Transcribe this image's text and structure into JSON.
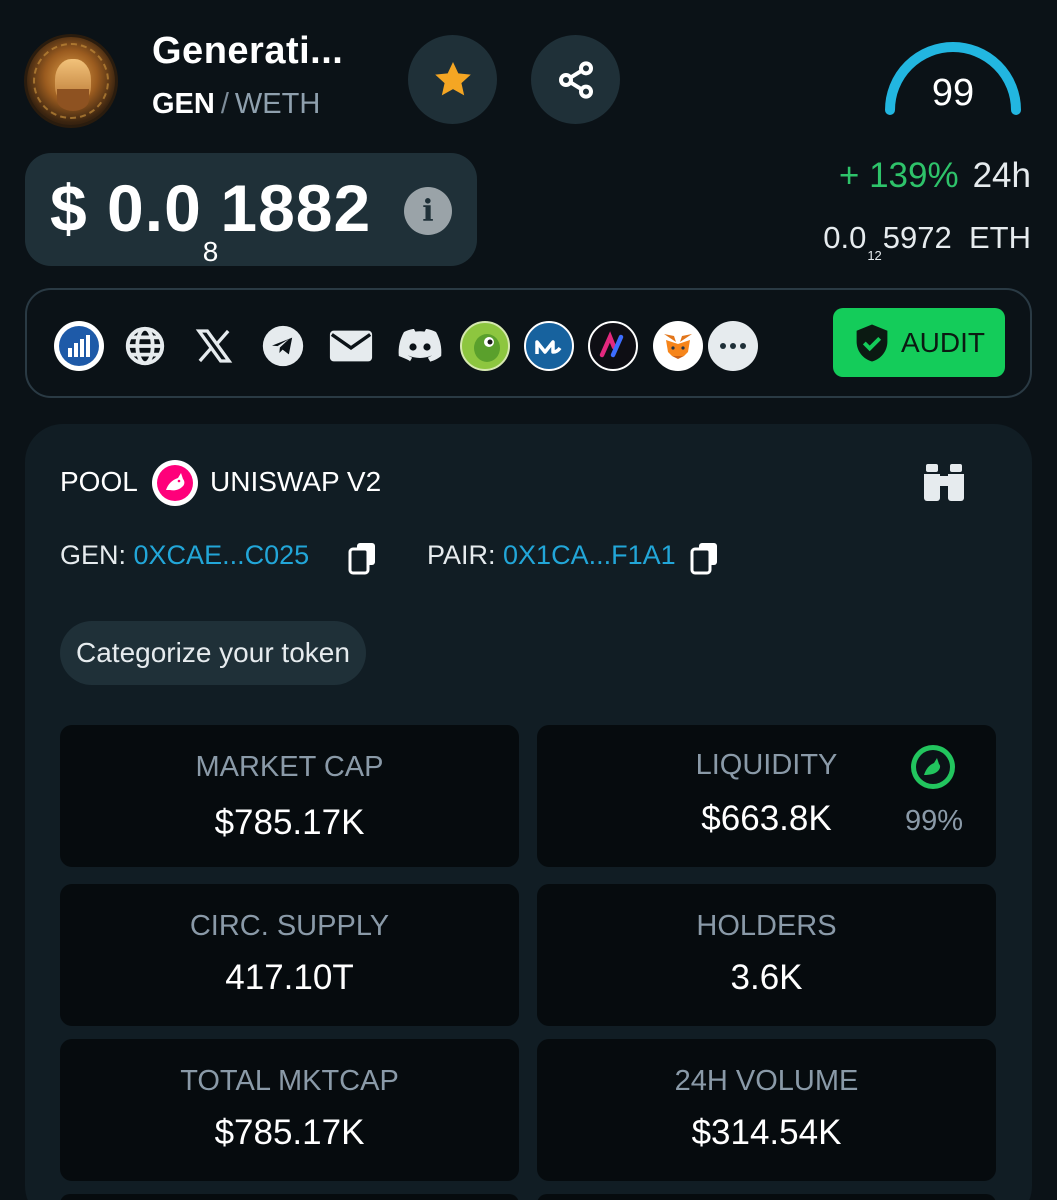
{
  "token": {
    "name": "Generati...",
    "base_symbol": "GEN",
    "separator": "/",
    "quote_symbol": "WETH"
  },
  "header_actions": {
    "favorite_icon": "star-icon",
    "share_icon": "share-icon"
  },
  "score": {
    "value": "99",
    "level": 0.99
  },
  "price": {
    "prefix": "$ 0.0",
    "zero_count": "8",
    "digits": "1882",
    "info_icon": "info-icon"
  },
  "change": {
    "value": "+ 139%",
    "period": "24h",
    "color": "#2ec36a"
  },
  "eth_price": {
    "prefix": "0.0",
    "zero_count": "12",
    "digits": "5972",
    "unit": "ETH"
  },
  "links": {
    "icons": [
      "chart-app-icon",
      "globe-icon",
      "x-icon",
      "telegram-icon",
      "mail-icon",
      "discord-icon",
      "coingecko-icon",
      "coinmarketcap-icon",
      "app-icon",
      "metamask-icon",
      "more-icon"
    ],
    "audit_label": "AUDIT",
    "audit_color": "#14cc5a"
  },
  "pool": {
    "label": "POOL",
    "dex": "UNISWAP V2",
    "token_label": "GEN:",
    "token_address": "0XCAE...C025",
    "pair_label": "PAIR:",
    "pair_address": "0X1CA...F1A1",
    "category_button": "Categorize your token"
  },
  "stats": {
    "market_cap": {
      "label": "MARKET CAP",
      "value": "$785.17K"
    },
    "liquidity": {
      "label": "LIQUIDITY",
      "value": "$663.8K",
      "locked_pct": "99%"
    },
    "circ_supply": {
      "label": "CIRC. SUPPLY",
      "value": "417.10T"
    },
    "holders": {
      "label": "HOLDERS",
      "value": "3.6K"
    },
    "total_mktcap": {
      "label": "TOTAL MKTCAP",
      "value": "$785.17K"
    },
    "volume_24h": {
      "label": "24H VOLUME",
      "value": "$314.54K"
    }
  }
}
